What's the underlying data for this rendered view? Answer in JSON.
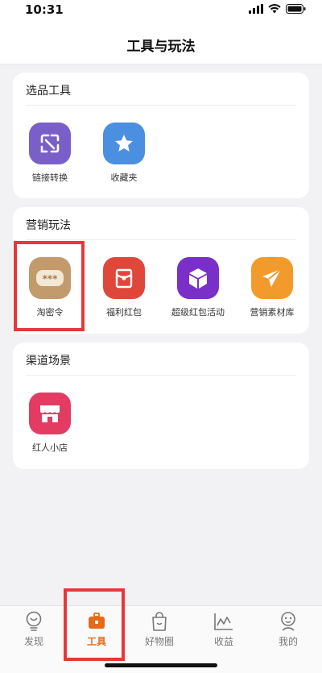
{
  "status_bar": {
    "time": "10:31"
  },
  "nav": {
    "title": "工具与玩法"
  },
  "sections": {
    "selection": {
      "title": "选品工具",
      "items": [
        {
          "label": "链接转换",
          "icon": "link-convert-icon",
          "color": "#7b5fc8"
        },
        {
          "label": "收藏夹",
          "icon": "favorites-star-icon",
          "color": "#4b8fe0"
        }
      ]
    },
    "marketing": {
      "title": "营销玩法",
      "items": [
        {
          "label": "淘密令",
          "icon": "password-token-icon",
          "color": "#c39a6b"
        },
        {
          "label": "福利红包",
          "icon": "red-envelope-icon",
          "color": "#e0473b"
        },
        {
          "label": "超级红包活动",
          "icon": "cube-icon",
          "color": "#7a2fc8"
        },
        {
          "label": "营销素材库",
          "icon": "paper-plane-icon",
          "color": "#f39a2d"
        }
      ]
    },
    "channel": {
      "title": "渠道场景",
      "items": [
        {
          "label": "红人小店",
          "icon": "shop-icon",
          "color": "#e43b62"
        }
      ]
    }
  },
  "tab_bar": {
    "active": "tools",
    "accent": "#e36b19",
    "tabs": [
      {
        "label": "发现",
        "icon": "discover-bulb-icon"
      },
      {
        "label": "工具",
        "icon": "toolbox-icon"
      },
      {
        "label": "好物圈",
        "icon": "shopping-bag-icon"
      },
      {
        "label": "收益",
        "icon": "earnings-chart-icon"
      },
      {
        "label": "我的",
        "icon": "profile-icon"
      }
    ]
  },
  "highlight_color": "#e5383b"
}
